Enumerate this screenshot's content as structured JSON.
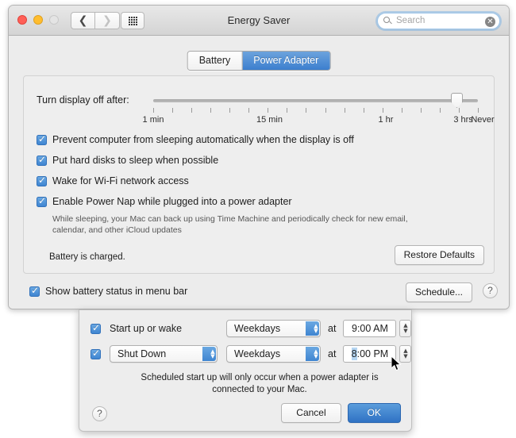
{
  "window": {
    "title": "Energy Saver",
    "traffic_lights": [
      "close",
      "minimize",
      "zoom"
    ],
    "nav": {
      "back_icon": "chevron-left-icon",
      "forward_icon": "chevron-right-icon",
      "show_all_icon": "grid-icon"
    },
    "search": {
      "placeholder": "Search",
      "value": "",
      "icon": "search-icon",
      "clear_icon": "clear-icon"
    }
  },
  "tabs": [
    {
      "label": "Battery",
      "active": false
    },
    {
      "label": "Power Adapter",
      "active": true
    }
  ],
  "slider": {
    "label": "Turn display off after:",
    "tick_labels": [
      "1 min",
      "15 min",
      "1 hr",
      "3 hrs",
      "Never"
    ],
    "tick_positions": [
      0,
      6,
      12,
      16,
      17
    ],
    "tick_count": 18,
    "value_index": 16,
    "value": "3 hrs"
  },
  "options": [
    {
      "label": "Prevent computer from sleeping automatically when the display is off",
      "checked": true
    },
    {
      "label": "Put hard disks to sleep when possible",
      "checked": true
    },
    {
      "label": "Wake for Wi-Fi network access",
      "checked": true
    },
    {
      "label": "Enable Power Nap while plugged into a power adapter",
      "checked": true
    }
  ],
  "power_nap_help": "While sleeping, your Mac can back up using Time Machine and periodically check for new email, calendar, and other iCloud updates",
  "status_text": "Battery is charged.",
  "restore_defaults_label": "Restore Defaults",
  "bottom": {
    "show_battery_label": "Show battery status in menu bar",
    "show_battery_checked": true,
    "schedule_label": "Schedule...",
    "help_label": "?"
  },
  "sheet": {
    "startup_row": {
      "checked": true,
      "label": "Start up or wake",
      "days": "Weekdays",
      "at_label": "at",
      "time": "9:00 AM",
      "time_selected_part": ""
    },
    "shutdown_row": {
      "checked": true,
      "action": "Shut Down",
      "days": "Weekdays",
      "at_label": "at",
      "time_selected_part": "8",
      "time_rest": ":00 PM"
    },
    "note": "Scheduled start up will only occur when a power adapter is connected to your Mac.",
    "help_label": "?",
    "cancel_label": "Cancel",
    "ok_label": "OK"
  },
  "colors": {
    "accent_blue": "#3f85d1",
    "selected_tab": "#3c7fce",
    "text_selection": "#b4d5f2",
    "window_bg": "#ececec"
  }
}
